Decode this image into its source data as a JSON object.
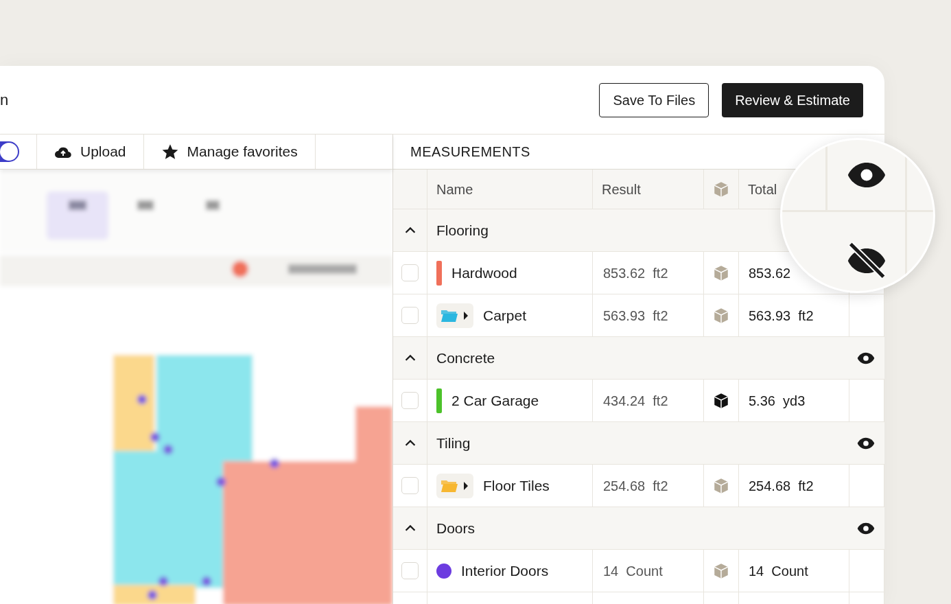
{
  "header": {
    "title": "n",
    "buttons": [
      {
        "label": "Save To Files",
        "kind": "outline"
      },
      {
        "label": "Review & Estimate",
        "kind": "primary"
      }
    ]
  },
  "toolbar": {
    "toggle": {
      "on": true
    },
    "items": [
      {
        "label": "Upload",
        "kind": "upload"
      },
      {
        "label": "Manage favorites",
        "kind": "favorites"
      }
    ]
  },
  "measurements": {
    "title": "MEASUREMENTS",
    "columns": [
      "Name",
      "Result",
      "Total"
    ],
    "groups": [
      {
        "name": "Flooring",
        "expanded": true,
        "visible": false,
        "items": [
          {
            "name": "Hardwood",
            "kind": "bar",
            "color": "#f0705a",
            "checked": false,
            "result": "853.62",
            "result_unit": "ft2",
            "volume": false,
            "total": "853.62"
          },
          {
            "name": "Carpet",
            "kind": "folder",
            "color": "#2bb7e0",
            "checked": false,
            "result": "563.93",
            "result_unit": "ft2",
            "volume": false,
            "total": "563.93",
            "total_unit": "ft2"
          }
        ]
      },
      {
        "name": "Concrete",
        "expanded": true,
        "visible": true,
        "items": [
          {
            "name": "2 Car Garage",
            "kind": "bar",
            "color": "#4cc22a",
            "checked": false,
            "result": "434.24",
            "result_unit": "ft2",
            "volume": true,
            "total": "5.36",
            "total_unit": "yd3"
          }
        ]
      },
      {
        "name": "Tiling",
        "expanded": true,
        "visible": true,
        "items": [
          {
            "name": "Floor Tiles",
            "kind": "folder",
            "color": "#f7b731",
            "checked": false,
            "result": "254.68",
            "result_unit": "ft2",
            "volume": false,
            "total": "254.68",
            "total_unit": "ft2"
          }
        ]
      },
      {
        "name": "Doors",
        "expanded": true,
        "visible": true,
        "items": [
          {
            "name": "Interior Doors",
            "kind": "dot",
            "color": "#6c3ce0",
            "checked": false,
            "result": "14",
            "result_unit": "Count",
            "volume": false,
            "total": "14",
            "total_unit": "Count"
          }
        ]
      }
    ]
  }
}
